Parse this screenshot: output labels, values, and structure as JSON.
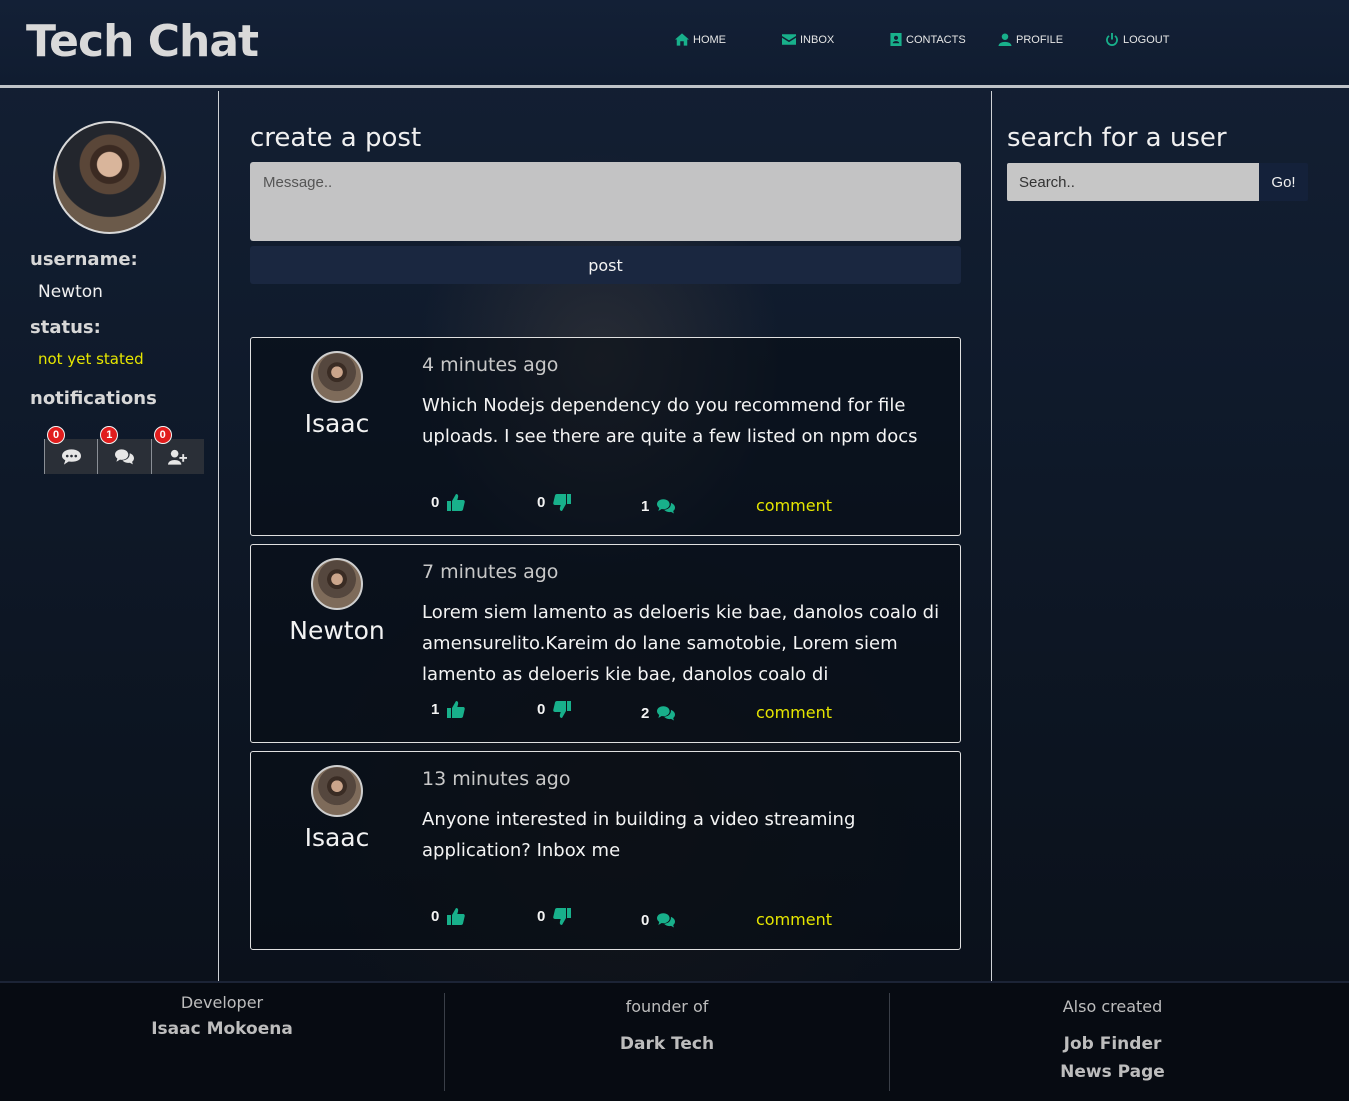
{
  "app": {
    "title": "Tech Chat"
  },
  "nav": {
    "home": "HOME",
    "inbox": "INBOX",
    "contacts": "CONTACTS",
    "profile": "PROFILE",
    "logout": "LOGOUT"
  },
  "profile": {
    "username_label": "username:",
    "username": "Newton",
    "status_label": "status:",
    "status": "not yet stated",
    "notifications_label": "notifications",
    "notifications": [
      {
        "icon": "message-icon",
        "count": "0"
      },
      {
        "icon": "comments-icon",
        "count": "1"
      },
      {
        "icon": "add-user-icon",
        "count": "0"
      }
    ]
  },
  "composer": {
    "title": "create a post",
    "placeholder": "Message..",
    "post_label": "post"
  },
  "posts": [
    {
      "author": "Isaac",
      "time": "4 minutes ago",
      "text": "Which Nodejs dependency do you recommend for file uploads. I see there are quite a few listed on npm docs",
      "likes": "0",
      "dislikes": "0",
      "comments": "1",
      "comment_label": "comment"
    },
    {
      "author": "Newton",
      "time": "7 minutes ago",
      "text": "Lorem siem lamento as deloeris kie bae, danolos coalo di amensurelito.Kareim do lane samotobie, Lorem siem lamento as deloeris kie bae, danolos coalo di amensurelito.Kareim do lane",
      "likes": "1",
      "dislikes": "0",
      "comments": "2",
      "comment_label": "comment"
    },
    {
      "author": "Isaac",
      "time": "13 minutes ago",
      "text": "Anyone interested in building a video streaming application? Inbox me",
      "likes": "0",
      "dislikes": "0",
      "comments": "0",
      "comment_label": "comment"
    }
  ],
  "search": {
    "title": "search for a user",
    "placeholder": "Search..",
    "button": "Go!"
  },
  "footer": {
    "developer_label": "Developer",
    "developer_name": "Isaac Mokoena",
    "founder_label": "founder of",
    "founder_company": "Dark Tech",
    "also_label": "Also created",
    "projects": [
      "Job Finder",
      "News Page"
    ]
  },
  "colors": {
    "accent": "#18b08b",
    "highlight": "#e6e600",
    "badge": "#e11d1d"
  }
}
